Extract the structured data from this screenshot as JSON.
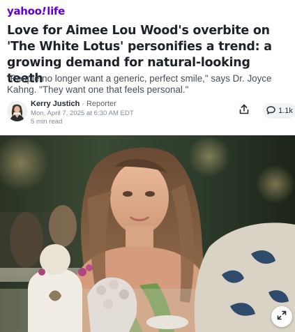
{
  "brand": {
    "logo_prefix": "yahoo",
    "logo_bang": "!",
    "logo_suffix": "life"
  },
  "article": {
    "headline": "Love for Aimee Lou Wood's overbite on 'The White Lotus' personifies a trend: a growing demand for natural-looking teeth",
    "subhead": "\"People no longer want a generic, perfect smile,\" says Dr. Joyce Kahng. \"They want one that feels personal.\""
  },
  "byline": {
    "author": "Kerry Justich",
    "separator": "·",
    "role": "Reporter",
    "date": "Mon, April 7, 2025 at 6:30 AM EDT",
    "read_time": "5 min read"
  },
  "actions": {
    "share_icon": "share-icon",
    "comment_icon": "comment-icon",
    "comment_count": "1.1k",
    "expand_icon": "expand-icon"
  },
  "colors": {
    "brand": "#6001d2",
    "headline": "#1d2228",
    "subtext": "#464e56",
    "meta": "#828a93",
    "pill_bg": "#f0f3f5"
  }
}
